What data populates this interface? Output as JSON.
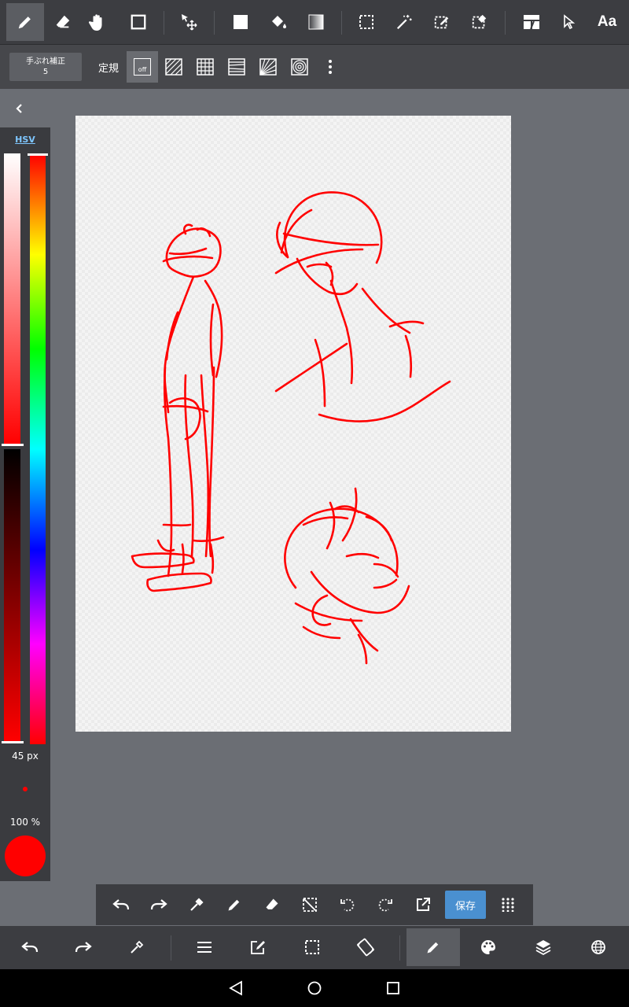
{
  "toolbar": {
    "text_tool_label": "Aa"
  },
  "subbar": {
    "stabilizer_label": "手ぶれ補正",
    "stabilizer_value": "5",
    "ruler_label": "定規",
    "ruler_off_label": "off"
  },
  "color_panel": {
    "mode_label": "HSV",
    "brush_size": "45 px",
    "opacity": "100 %",
    "current_color": "#ff0000"
  },
  "quickbar": {
    "save_label": "保存"
  },
  "colors": {
    "toolbar_bg": "#3c3d41",
    "accent_blue": "#4a90d0",
    "stroke_red": "#ff0000"
  },
  "icons": [
    "pen-icon",
    "eraser-icon",
    "hand-icon",
    "square-shape-icon",
    "move-icon",
    "fill-rect-icon",
    "bucket-icon",
    "gradient-icon",
    "select-rect-icon",
    "magic-wand-icon",
    "select-pen-icon",
    "select-eraser-icon",
    "panel-icon",
    "pointer-icon",
    "undo-icon",
    "redo-icon",
    "eyedropper-icon",
    "menu-icon",
    "edit-icon",
    "selection-icon",
    "rotate-screen-icon",
    "palette-icon",
    "layers-icon",
    "globe-icon",
    "back-nav-icon",
    "home-nav-icon",
    "recents-nav-icon"
  ]
}
